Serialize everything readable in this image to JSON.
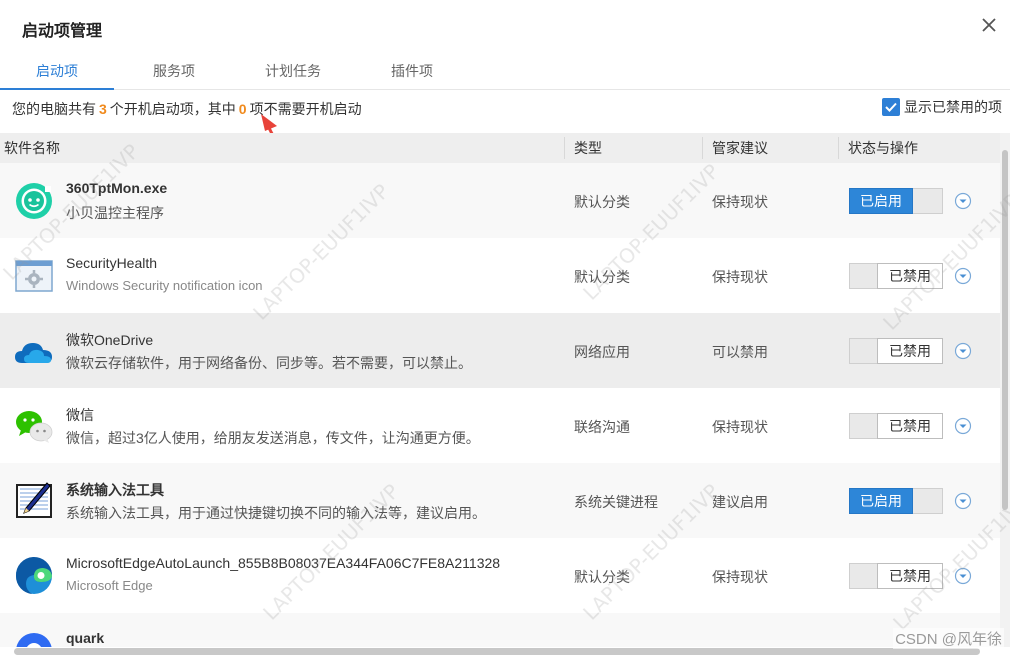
{
  "window": {
    "title": "启动项管理"
  },
  "tabs": [
    {
      "label": "启动项",
      "active": true
    },
    {
      "label": "服务项",
      "active": false
    },
    {
      "label": "计划任务",
      "active": false
    },
    {
      "label": "插件项",
      "active": false
    }
  ],
  "summary": {
    "part1": "您的电脑共有",
    "total": "3",
    "part2": "个开机启动项，其中",
    "unneeded": "0",
    "part3": "项不需要开机启动"
  },
  "show_disabled": {
    "label": "显示已禁用的项",
    "checked": true
  },
  "columns": {
    "name": "软件名称",
    "type": "类型",
    "advice": "管家建议",
    "status": "状态与操作"
  },
  "rows": [
    {
      "name": "360TptMon.exe",
      "desc": "小贝温控主程序",
      "type": "默认分类",
      "advice": "保持现状",
      "status": "已启用",
      "enabled": true,
      "icon": "chat-bot-icon"
    },
    {
      "name": "SecurityHealth",
      "desc": "Windows Security notification icon",
      "type": "默认分类",
      "advice": "保持现状",
      "status": "已禁用",
      "enabled": false,
      "icon": "settings-window-icon"
    },
    {
      "name": "微软OneDrive",
      "desc": "微软云存储软件，用于网络备份、同步等。若不需要，可以禁止。",
      "type": "网络应用",
      "advice": "可以禁用",
      "status": "已禁用",
      "enabled": false,
      "icon": "cloud-icon"
    },
    {
      "name": "微信",
      "desc": "微信，超过3亿人使用，给朋友发送消息，传文件，让沟通更方便。",
      "type": "联络沟通",
      "advice": "保持现状",
      "status": "已禁用",
      "enabled": false,
      "icon": "wechat-icon"
    },
    {
      "name": "系统输入法工具",
      "desc": "系统输入法工具，用于通过快捷键切换不同的输入法等，建议启用。",
      "type": "系统关键进程",
      "advice": "建议启用",
      "status": "已启用",
      "enabled": true,
      "icon": "pen-icon"
    },
    {
      "name": "MicrosoftEdgeAutoLaunch_855B8B08037EA344FA06C7FE8A211328",
      "desc": "Microsoft Edge",
      "type": "默认分类",
      "advice": "保持现状",
      "status": "已禁用",
      "enabled": false,
      "icon": "edge-icon"
    },
    {
      "name": "quark",
      "desc": "",
      "type": "",
      "advice": "",
      "status": "",
      "enabled": false,
      "icon": "quark-icon"
    }
  ],
  "watermark": "LAPTOP-EUUF1IVP",
  "credit": "CSDN @风年徐",
  "colors": {
    "accent": "#2d7fd6",
    "count": "#f08a1d",
    "arrow": "#e8433a"
  }
}
